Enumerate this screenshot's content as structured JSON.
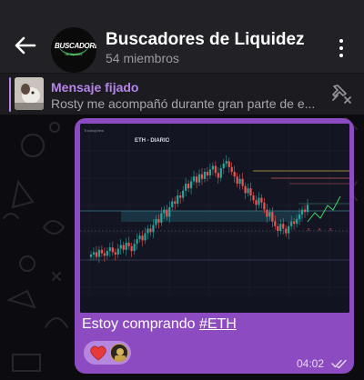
{
  "header": {
    "title": "Buscadores de Liquidez",
    "members": "54 miembros",
    "avatar_logo": "BUSCADORES",
    "avatar_logo_sub": "de liquidez"
  },
  "pinned": {
    "title": "Mensaje fijado",
    "text": "Rosty me acompañó durante gran parte de e..."
  },
  "message": {
    "caption_prefix": "Estoy comprando ",
    "caption_tag": "#ETH",
    "time": "04:02",
    "reactions": [
      "heart",
      "user-avatar"
    ],
    "chart_title": "ETH - DIARIO"
  },
  "colors": {
    "header_bg": "#222226",
    "accent": "#b685ea",
    "bubble": "#8c4bc1",
    "heart": "#e5393b",
    "candle_up": "#26a69a",
    "candle_down": "#ef5350"
  },
  "chart_data": {
    "type": "candlestick",
    "title": "ETH - DIARIO",
    "closes": [
      20,
      22,
      18,
      24,
      21,
      19,
      23,
      26,
      22,
      20,
      25,
      28,
      24,
      30,
      27,
      23,
      29,
      33,
      36,
      32,
      38,
      42,
      39,
      45,
      50,
      47,
      55,
      58,
      52,
      60,
      65,
      63,
      70,
      68,
      74,
      80,
      76,
      82,
      86,
      81,
      88,
      84,
      90,
      87,
      92,
      95,
      89,
      85,
      93,
      97,
      99,
      94,
      90,
      86,
      80,
      84,
      78,
      72,
      76,
      70,
      66,
      62,
      68,
      64,
      58,
      52,
      56,
      48,
      44,
      40,
      46,
      42,
      38,
      44,
      48,
      46,
      50,
      54,
      58,
      56,
      62
    ]
  }
}
